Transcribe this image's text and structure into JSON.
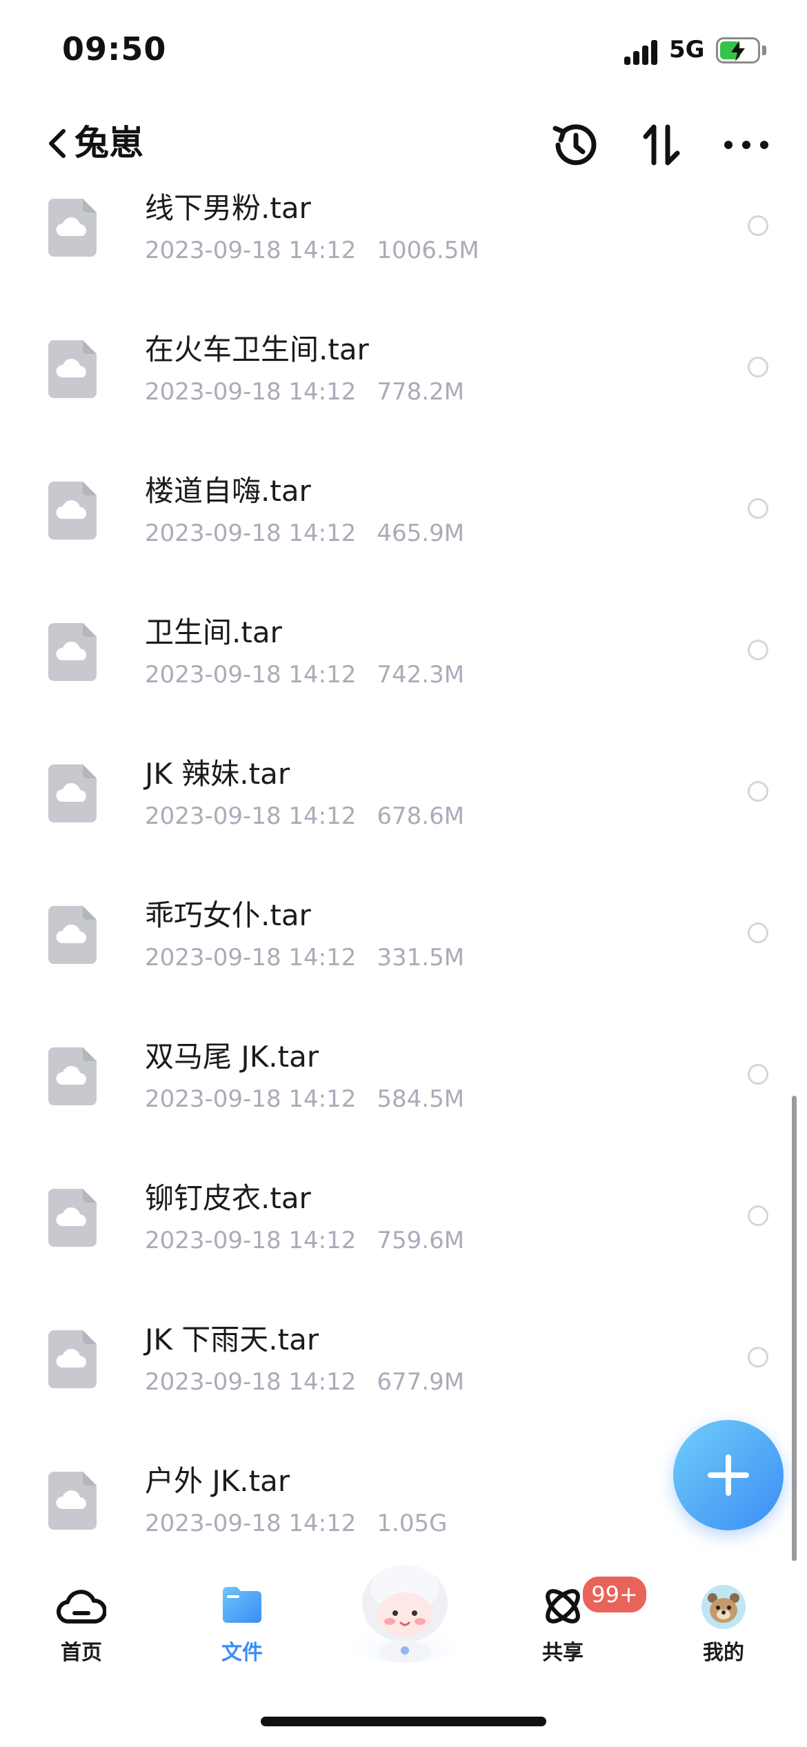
{
  "status_bar": {
    "time": "09:50",
    "network": "5G",
    "battery_level": 0.55,
    "battery_charging": true
  },
  "nav": {
    "title": "兔崽",
    "icons": [
      "back-icon",
      "history-icon",
      "sort-icon",
      "more-icon"
    ]
  },
  "files": [
    {
      "name": "线下男粉.tar",
      "date": "2023-09-18 14:12",
      "size": "1006.5M"
    },
    {
      "name": "在火车卫生间.tar",
      "date": "2023-09-18 14:12",
      "size": "778.2M"
    },
    {
      "name": "楼道自嗨.tar",
      "date": "2023-09-18 14:12",
      "size": "465.9M"
    },
    {
      "name": "卫生间.tar",
      "date": "2023-09-18 14:12",
      "size": "742.3M"
    },
    {
      "name": "JK 辣妹.tar",
      "date": "2023-09-18 14:12",
      "size": "678.6M"
    },
    {
      "name": "乖巧女仆.tar",
      "date": "2023-09-18 14:12",
      "size": "331.5M"
    },
    {
      "name": "双马尾 JK.tar",
      "date": "2023-09-18 14:12",
      "size": "584.5M"
    },
    {
      "name": "铆钉皮衣.tar",
      "date": "2023-09-18 14:12",
      "size": "759.6M"
    },
    {
      "name": "JK 下雨天.tar",
      "date": "2023-09-18 14:12",
      "size": "677.9M"
    },
    {
      "name": "户外 JK.tar",
      "date": "2023-09-18 14:12",
      "size": "1.05G"
    }
  ],
  "fab": {
    "icon": "plus-icon",
    "color": "#3b8ef6"
  },
  "tab_bar": {
    "tabs": [
      {
        "label": "首页",
        "icon": "cloud-icon",
        "active": false
      },
      {
        "label": "文件",
        "icon": "folder-icon",
        "active": true
      },
      {
        "label": "共享",
        "icon": "share-orbit-icon",
        "active": false
      },
      {
        "label": "我的",
        "icon": "avatar-icon",
        "active": false
      }
    ],
    "share_badge": "99+",
    "active_color": "#3a8df6",
    "badge_color": "#e8645a"
  }
}
